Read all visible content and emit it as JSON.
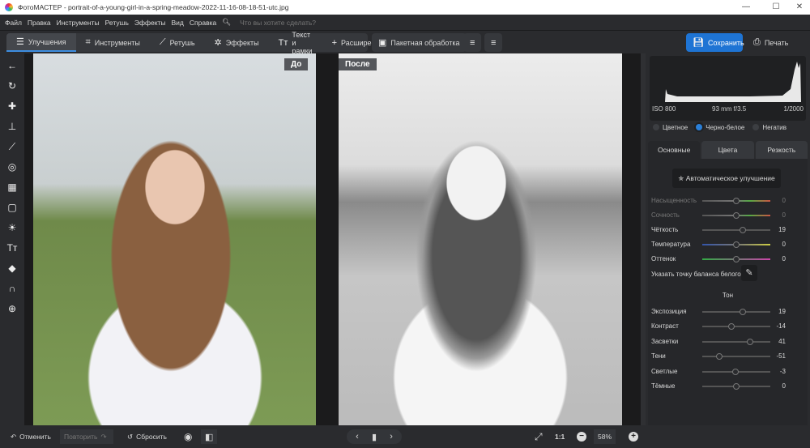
{
  "window": {
    "title": "ФотоМАСТЕР - portrait-of-a-young-girl-in-a-spring-meadow-2022-11-16-08-18-51-utc.jpg"
  },
  "menu": {
    "items": [
      "Файл",
      "Правка",
      "Инструменты",
      "Ретушь",
      "Эффекты",
      "Вид",
      "Справка"
    ],
    "search_placeholder": "Что вы хотите сделать?"
  },
  "toolbar": {
    "tabs": [
      "Улучшения",
      "Инструменты",
      "Ретушь",
      "Эффекты",
      "Текст и рамки",
      "Расширения"
    ],
    "batch": "Пакетная обработка",
    "save": "Сохранить",
    "print": "Печать"
  },
  "canvas": {
    "before_label": "До",
    "after_label": "После"
  },
  "histogram": {
    "iso": "ISO 800",
    "lens": "93 mm f/3.5",
    "shutter": "1/2000"
  },
  "mode": {
    "options": [
      "Цветное",
      "Черно-белое",
      "Негатив"
    ],
    "selected": 1
  },
  "panel_tabs": [
    "Основные",
    "Цвета",
    "Резкость"
  ],
  "auto_button": "Автоматическое улучшение",
  "sliders_basic": [
    {
      "label": "Насыщенность",
      "value": "0",
      "num": 0,
      "disabled": true
    },
    {
      "label": "Сочность",
      "value": "0",
      "num": 0,
      "disabled": true
    },
    {
      "label": "Чёткость",
      "value": "19",
      "num": 19
    },
    {
      "label": "Температура",
      "value": "0",
      "num": 0
    },
    {
      "label": "Оттенок",
      "value": "0",
      "num": 0
    }
  ],
  "white_balance": "Указать точку баланса белого",
  "tone_header": "Тон",
  "sliders_tone": [
    {
      "label": "Экспозиция",
      "value": "19",
      "num": 19
    },
    {
      "label": "Контраст",
      "value": "-14",
      "num": -14
    },
    {
      "label": "Засветки",
      "value": "41",
      "num": 41
    },
    {
      "label": "Тени",
      "value": "-51",
      "num": -51
    },
    {
      "label": "Светлые",
      "value": "-3",
      "num": -3
    },
    {
      "label": "Тёмные",
      "value": "0",
      "num": 0
    }
  ],
  "bottom": {
    "undo": "Отменить",
    "redo": "Повторить",
    "reset": "Сбросить",
    "ratio": "1:1",
    "zoom": "58%"
  },
  "colors": {
    "accent": "#1e74d4"
  }
}
